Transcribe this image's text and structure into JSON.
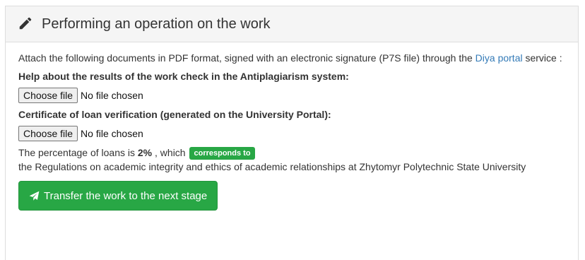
{
  "panel": {
    "title": "Performing an operation on the work",
    "title_icon": "pencil-icon"
  },
  "intro": {
    "text_before": "Attach the following documents in PDF format, signed with an electronic signature (P7S file) through the ",
    "link_text": "Diya portal",
    "text_after": " service :"
  },
  "antiplagiarism": {
    "label": "Help about the results of the work check in the Antiplagiarism system:",
    "button_label": "Choose file",
    "status": "No file chosen"
  },
  "loan_certificate": {
    "label": "Certificate of loan verification (generated on the University Portal):",
    "button_label": "Choose file",
    "status": "No file chosen"
  },
  "percentage": {
    "prefix": "The percentage of loans is ",
    "value": "2%",
    "suffix": " , which ",
    "badge": "corresponds to",
    "regulations": "the Regulations on academic integrity and ethics of academic relationships at Zhytomyr Polytechnic State University"
  },
  "submit": {
    "label": "Transfer the work to the next stage",
    "icon": "send-icon"
  },
  "colors": {
    "success": "#28a745",
    "link": "#337ab7",
    "heading_bg": "#f5f5f5"
  }
}
